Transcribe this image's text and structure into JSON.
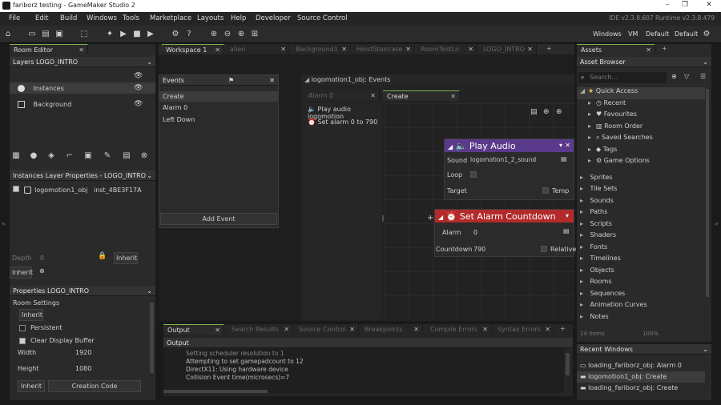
{
  "window": {
    "title": "fariborz testing - GameMaker Studio 2"
  },
  "menu": [
    "File",
    "Edit",
    "Build",
    "Windows",
    "Tools",
    "Marketplace",
    "Layouts",
    "Help",
    "Developer",
    "Source Control"
  ],
  "version_text": "IDE v2.3.8.607  Runtime v2.3.8.479",
  "layout_opts": [
    "Windows",
    "VM",
    "Default",
    "Default"
  ],
  "room_editor": {
    "tab": "Room Editor",
    "layers_label": "Layers  LOGO_INTRO",
    "layers": [
      "Instances",
      "Background"
    ],
    "instances_props": "Instances Layer Properties - LOGO_INTRO",
    "instance_obj": "logomotion1_obj",
    "instance_id": "inst_4BE3F17A",
    "depth_label": "Depth",
    "depth_value": "0",
    "inherit": "Inherit",
    "inherit2": "Inherit",
    "properties_label": "Properties  LOGO_INTRO",
    "room_settings": "Room Settings",
    "inherit3": "Inherit",
    "persistent": "Persistent",
    "clear_display": "Clear Display Buffer",
    "width_label": "Width",
    "width_value": "1920",
    "height_label": "Height",
    "height_value": "1080",
    "inherit4": "Inherit",
    "creation_code": "Creation Code"
  },
  "workspace_tabs": [
    {
      "label": "Workspace 1",
      "active": true
    },
    {
      "label": "alien",
      "active": false
    },
    {
      "label": "Background1",
      "active": false
    },
    {
      "label": "HeistStaircase",
      "active": false
    },
    {
      "label": "RoomTestLn",
      "active": false
    },
    {
      "label": "LOGO_INTRO",
      "active": false
    }
  ],
  "events_panel": {
    "title": "Events",
    "items": [
      "Create",
      "Alarm 0",
      "Left Down"
    ],
    "add_event": "Add Event"
  },
  "code_panel": {
    "title": "logomotion1_obj: Events",
    "tabs": [
      "Alarm 0",
      "Create"
    ],
    "actions": [
      "Play audio logomotion",
      "Set alarm 0 to 790"
    ]
  },
  "play_audio": {
    "title": "Play Audio",
    "sound_label": "Sound",
    "sound_value": "logomotion1_2_sound",
    "loop_label": "Loop",
    "target_label": "Target",
    "temp_label": "Temp"
  },
  "set_alarm": {
    "title": "Set Alarm Countdown",
    "alarm_label": "Alarm",
    "alarm_value": "0",
    "countdown_label": "Countdown",
    "countdown_value": "790",
    "relative_label": "Relative"
  },
  "output": {
    "tabs": [
      "Output",
      "Search Results",
      "Source Control",
      "Breakpoints",
      "Compile Errors",
      "Syntax Errors"
    ],
    "header": "Output",
    "lines": [
      "Setting scheduler resolution to 1",
      "Attempting to set gamepadcount to 12",
      "DirectX11: Using hardware device",
      "Collision Event time(microsecs)=7"
    ]
  },
  "assets": {
    "tab": "Assets",
    "browser": "Asset Browser",
    "search_placeholder": "Search...",
    "quick_access": "Quick Access",
    "quick_items": [
      "Recent",
      "Favourites",
      "Room Order",
      "Saved Searches",
      "Tags",
      "Game Options"
    ],
    "groups": [
      "Sprites",
      "Tile Sets",
      "Sounds",
      "Paths",
      "Scripts",
      "Shaders",
      "Fonts",
      "Timelines",
      "Objects",
      "Rooms",
      "Sequences",
      "Animation Curves",
      "Notes"
    ],
    "items_count": "14 items",
    "zoom": "100%"
  },
  "recent_windows": {
    "title": "Recent Windows",
    "items": [
      "loading_fariborz_obj: Alarm 0",
      "logomotion1_obj: Create",
      "loading_fariborz_obj: Create"
    ]
  },
  "colors": {
    "play_audio": "#5a3a8a",
    "set_alarm": "#b32a2a",
    "accent_green": "#7bb34a"
  }
}
